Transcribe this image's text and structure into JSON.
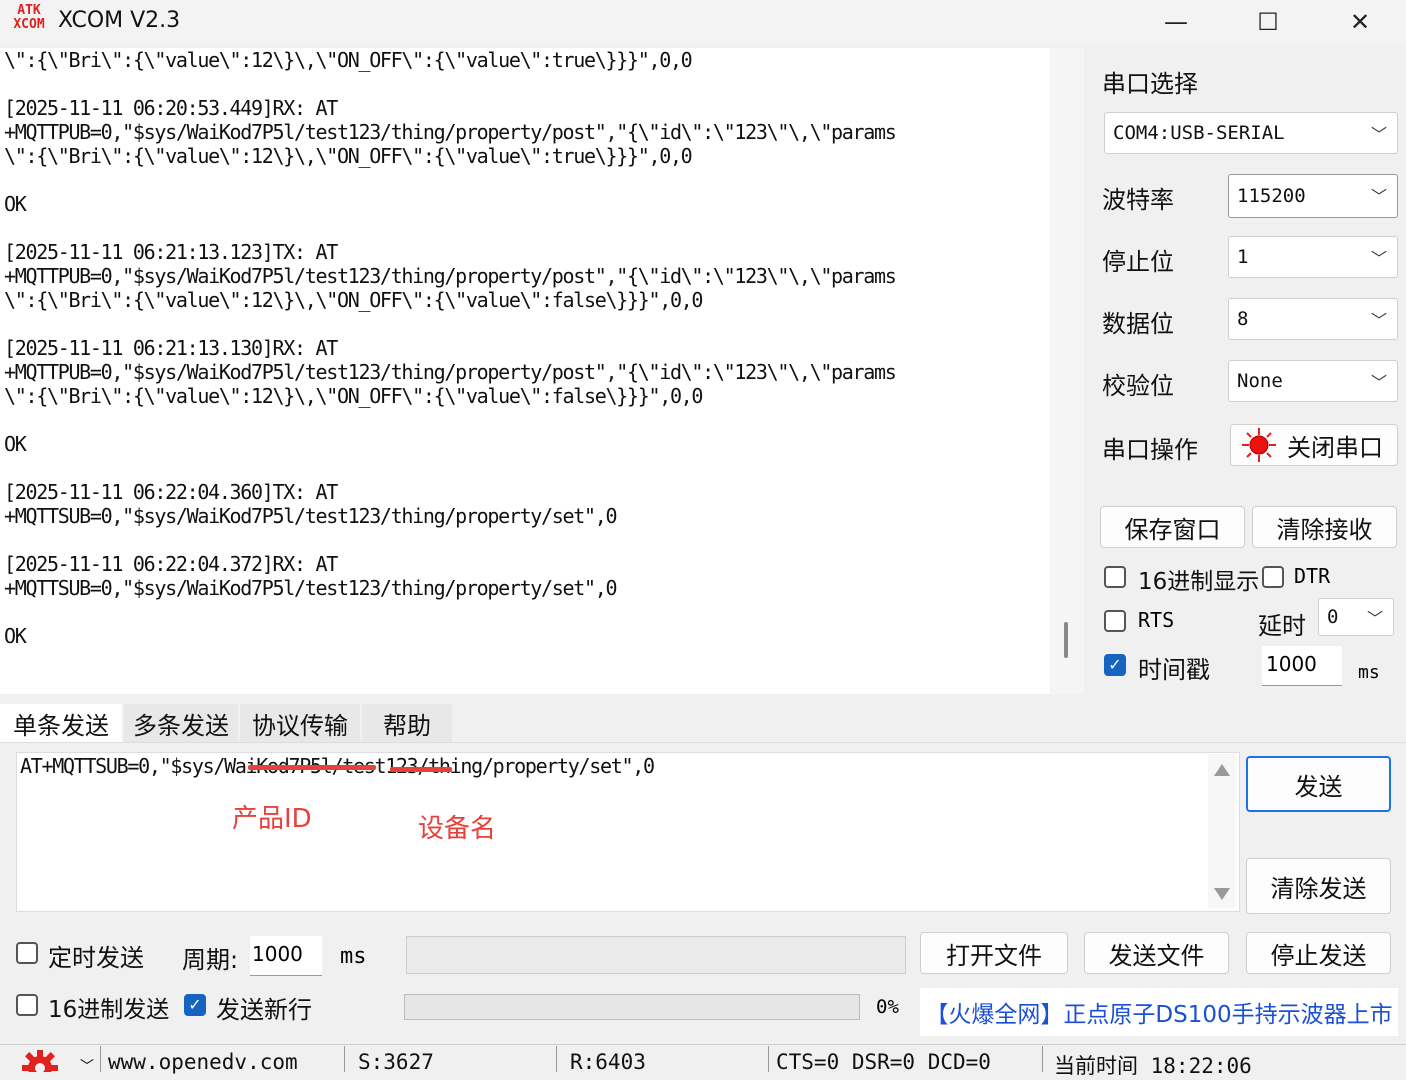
{
  "window": {
    "logo_top": "ATK",
    "logo_bottom": "XCOM",
    "title": "XCOM V2.3",
    "minimize": "—",
    "maximize": "☐",
    "close": "✕"
  },
  "receive": {
    "text": "\\\":{\\\"Bri\\\":{\\\"value\\\":12\\}\\,\\\"ON_OFF\\\":{\\\"value\\\":true\\}}}\",0,0\n\n[2025-11-11 06:20:53.449]RX: AT\n+MQTTPUB=0,\"$sys/WaiKod7P5l/test123/thing/property/post\",\"{\\\"id\\\":\\\"123\\\"\\,\\\"params\n\\\":{\\\"Bri\\\":{\\\"value\\\":12\\}\\,\\\"ON_OFF\\\":{\\\"value\\\":true\\}}}\",0,0\n\nOK\n\n[2025-11-11 06:21:13.123]TX: AT\n+MQTTPUB=0,\"$sys/WaiKod7P5l/test123/thing/property/post\",\"{\\\"id\\\":\\\"123\\\"\\,\\\"params\n\\\":{\\\"Bri\\\":{\\\"value\\\":12\\}\\,\\\"ON_OFF\\\":{\\\"value\\\":false\\}}}\",0,0\n\n[2025-11-11 06:21:13.130]RX: AT\n+MQTTPUB=0,\"$sys/WaiKod7P5l/test123/thing/property/post\",\"{\\\"id\\\":\\\"123\\\"\\,\\\"params\n\\\":{\\\"Bri\\\":{\\\"value\\\":12\\}\\,\\\"ON_OFF\\\":{\\\"value\\\":false\\}}}\",0,0\n\nOK\n\n[2025-11-11 06:22:04.360]TX: AT\n+MQTTSUB=0,\"$sys/WaiKod7P5l/test123/thing/property/set\",0\n\n[2025-11-11 06:22:04.372]RX: AT\n+MQTTSUB=0,\"$sys/WaiKod7P5l/test123/thing/property/set\",0\n\nOK"
  },
  "panel": {
    "port_label": "串口选择",
    "port_value": "COM4:USB-SERIAL",
    "baud_label": "波特率",
    "baud_value": "115200",
    "stop_label": "停止位",
    "stop_value": "1",
    "data_label": "数据位",
    "data_value": "8",
    "parity_label": "校验位",
    "parity_value": "None",
    "op_label": "串口操作",
    "op_button": "关闭串口",
    "save_window": "保存窗口",
    "clear_receive": "清除接收",
    "hex_display": "16进制显示",
    "dtr": "DTR",
    "rts": "RTS",
    "delay_label": "延时",
    "delay_value": "0",
    "timestamp": "时间戳",
    "timestamp_value": "1000",
    "ms": "ms",
    "chevron": "﹀",
    "check": "✓"
  },
  "tabs": [
    "单条发送",
    "多条发送",
    "协议传输",
    "帮助"
  ],
  "send": {
    "text": "AT+MQTTSUB=0,\"$sys/WaiKod7P5l/test123/thing/property/set\",0",
    "annotation_product": "产品ID",
    "annotation_device": "设备名",
    "send_button": "发送",
    "clear_send": "清除发送",
    "timed_send": "定时发送",
    "period_label": "周期:",
    "period_value": "1000",
    "period_unit": "ms",
    "open_file": "打开文件",
    "send_file": "发送文件",
    "stop_send": "停止发送",
    "hex_send": "16进制发送",
    "send_newline": "发送新行",
    "progress_percent": "0%",
    "progress_value": 0,
    "ad": "【火爆全网】正点原子DS100手持示波器上市"
  },
  "status": {
    "website": "www.openedv.com",
    "sent": "S:3627",
    "received": "R:6403",
    "lines": "CTS=0 DSR=0 DCD=0",
    "time": "当前时间 18:22:06"
  }
}
